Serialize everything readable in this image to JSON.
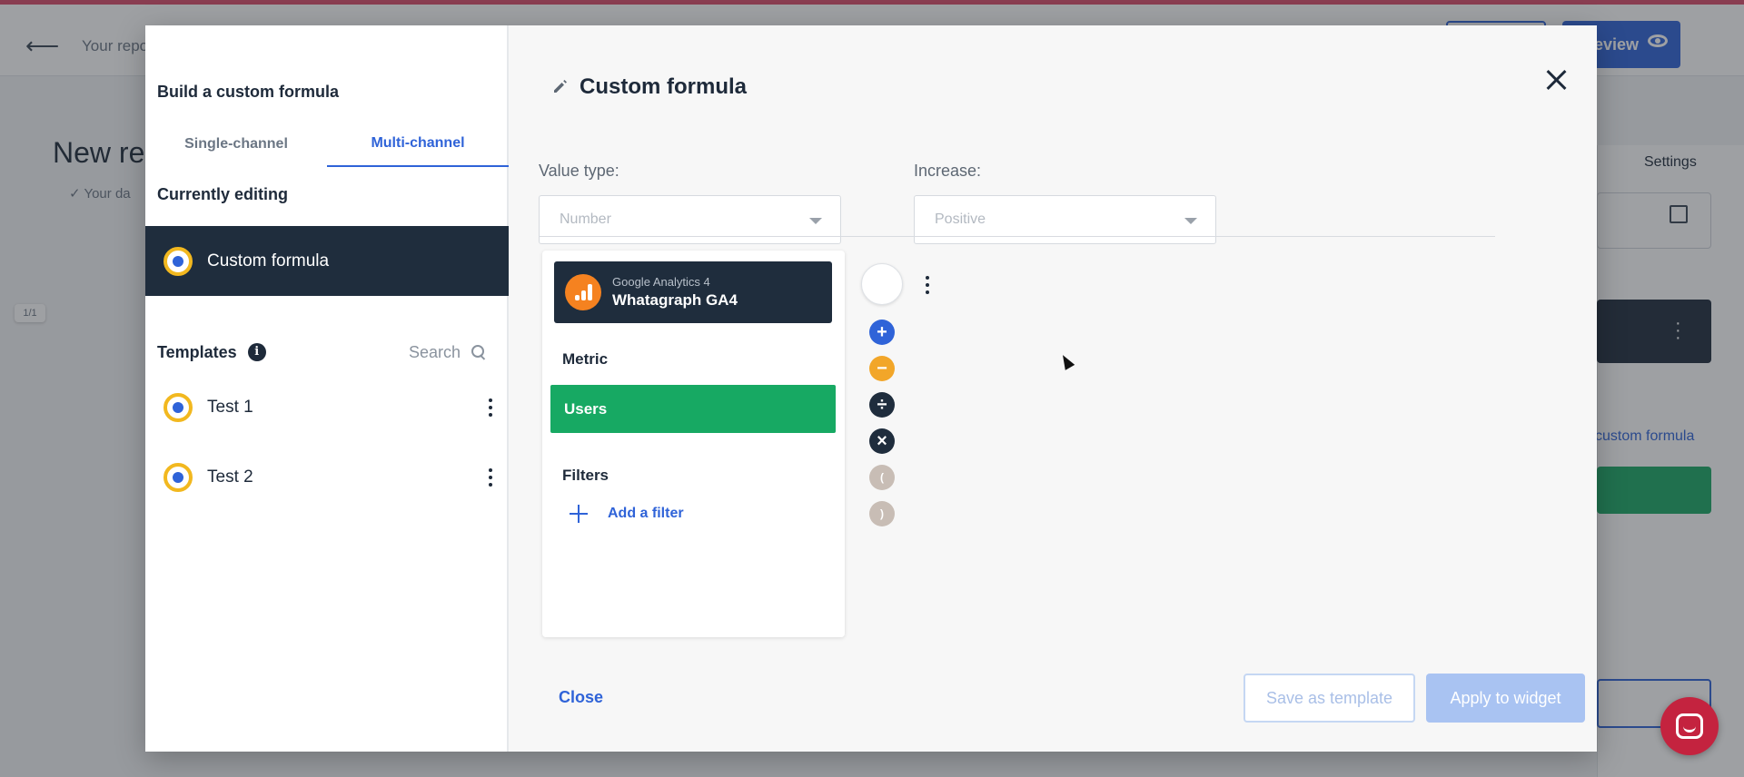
{
  "background": {
    "report_title": "Your repo",
    "report_heading": "New re",
    "report_sub": "✓ Your da",
    "page_badge": "1/1",
    "preview_label": "eview",
    "settings_label": "Settings",
    "custom_formula_link": "custom formula"
  },
  "sidebar": {
    "title": "Build a custom formula",
    "tabs": [
      {
        "label": "Single-channel",
        "active": false
      },
      {
        "label": "Multi-channel",
        "active": true
      }
    ],
    "currently_editing_label": "Currently editing",
    "current_item": "Custom formula",
    "templates_label": "Templates",
    "search_label": "Search",
    "templates": [
      {
        "label": "Test 1"
      },
      {
        "label": "Test 2"
      }
    ]
  },
  "editor": {
    "title": "Custom formula",
    "value_type_label": "Value type:",
    "value_type_value": "Number",
    "increase_label": "Increase:",
    "increase_value": "Positive",
    "source": {
      "provider": "Google Analytics 4",
      "account": "Whatagraph GA4",
      "metric_label": "Metric",
      "metric_value": "Users",
      "filters_label": "Filters",
      "add_filter_label": "Add a filter"
    },
    "operators": [
      {
        "name": "add",
        "symbol": "+",
        "color": "#2f63d8"
      },
      {
        "name": "subtract",
        "symbol": "−",
        "color": "#f2a629"
      },
      {
        "name": "divide",
        "symbol": "÷",
        "color": "#1f2d3d"
      },
      {
        "name": "multiply",
        "symbol": "×",
        "color": "#1f2d3d"
      },
      {
        "name": "open-paren",
        "symbol": "(",
        "color": "#c8bdb5"
      },
      {
        "name": "close-paren",
        "symbol": ")",
        "color": "#c8bdb5"
      }
    ]
  },
  "footer": {
    "close_label": "Close",
    "save_template_label": "Save as template",
    "apply_label": "Apply to widget"
  },
  "colors": {
    "accent": "#2f63d8",
    "dark": "#1f2d3d",
    "success": "#17a963",
    "brand_ring": "#f2b81f"
  }
}
